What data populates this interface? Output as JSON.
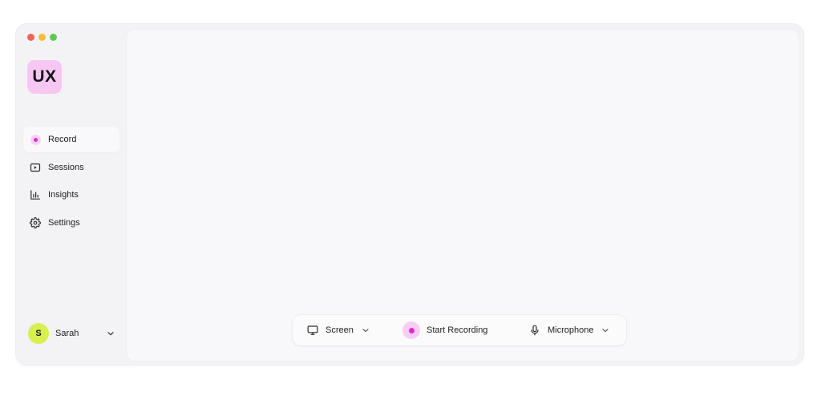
{
  "window": {
    "logo_text": "UX",
    "controls": [
      "close",
      "minimize",
      "maximize"
    ]
  },
  "sidebar": {
    "items": [
      {
        "label": "Record",
        "icon": "record-dot-icon",
        "active": true
      },
      {
        "label": "Sessions",
        "icon": "play-square-icon",
        "active": false
      },
      {
        "label": "Insights",
        "icon": "bar-chart-icon",
        "active": false
      },
      {
        "label": "Settings",
        "icon": "gear-icon",
        "active": false
      }
    ]
  },
  "user": {
    "initial": "S",
    "name": "Sarah",
    "avatar_color": "#d7f04f"
  },
  "toolbar": {
    "screen_label": "Screen",
    "record_label": "Start Recording",
    "microphone_label": "Microphone"
  },
  "colors": {
    "accent": "#dc2dd2",
    "accent_soft": "#f8cdf4",
    "logo_bg": "#f6c7f2"
  }
}
